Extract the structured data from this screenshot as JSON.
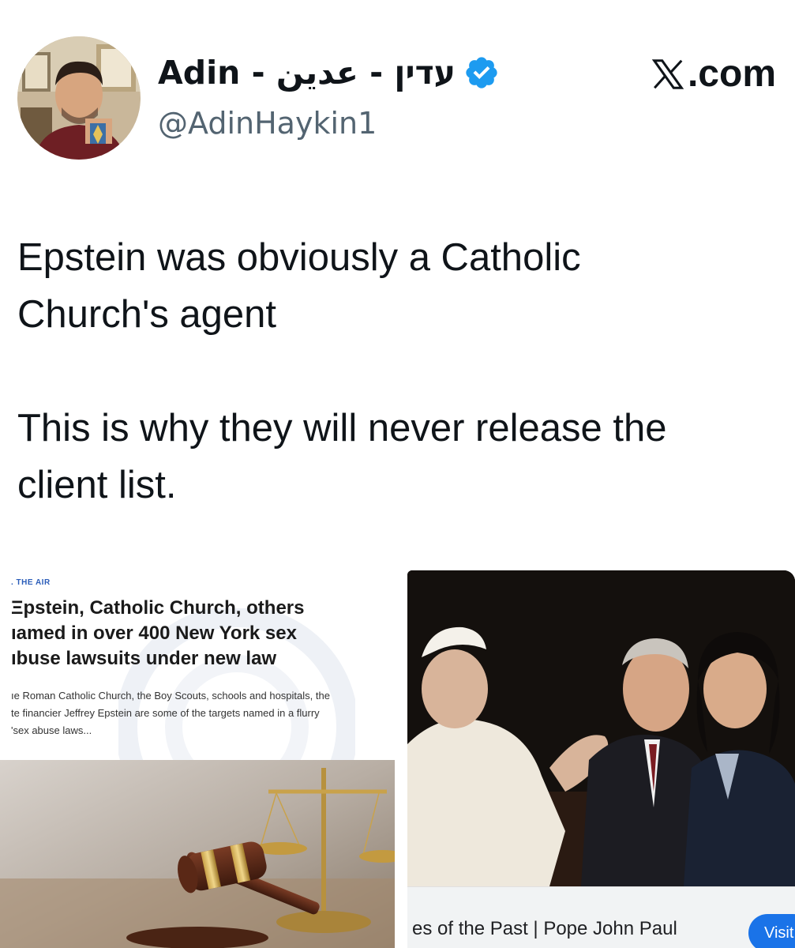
{
  "author": {
    "display_name": "Adin - עדין - عدين",
    "handle": "@AdinHaykin1",
    "verified": true,
    "avatar_icon": "user-avatar-photo"
  },
  "source": {
    "site_label": ".com",
    "logo_icon": "x-logo-icon"
  },
  "tweet": {
    "line1": "Epstein was obviously a Catholic",
    "line2": "Church's agent",
    "line3": "This is why they will never release the",
    "line4": "client list."
  },
  "attachments": {
    "left_card": {
      "section_tag": ". THE AIR",
      "headline": [
        "Ξpstein, Catholic Church, others",
        "ıamed in over 400 New York sex",
        "ıbuse lawsuits under new law"
      ],
      "summary": [
        "ıe Roman Catholic Church, the Boy Scouts, schools and hospitals, the",
        "te financier Jeffrey Epstein are some of the targets named in a flurry",
        "'sex abuse laws..."
      ],
      "image_icon": "gavel-scales-photo"
    },
    "right_card": {
      "image_icon": "pope-meeting-photo",
      "caption": "es of the Past | Pope John Paul",
      "visit_label": "Visit"
    }
  },
  "colors": {
    "verified_badge": "#1d9bf0",
    "handle_gray": "#536471",
    "visit_blue": "#1a73e8",
    "section_tag_blue": "#2b5db9"
  }
}
